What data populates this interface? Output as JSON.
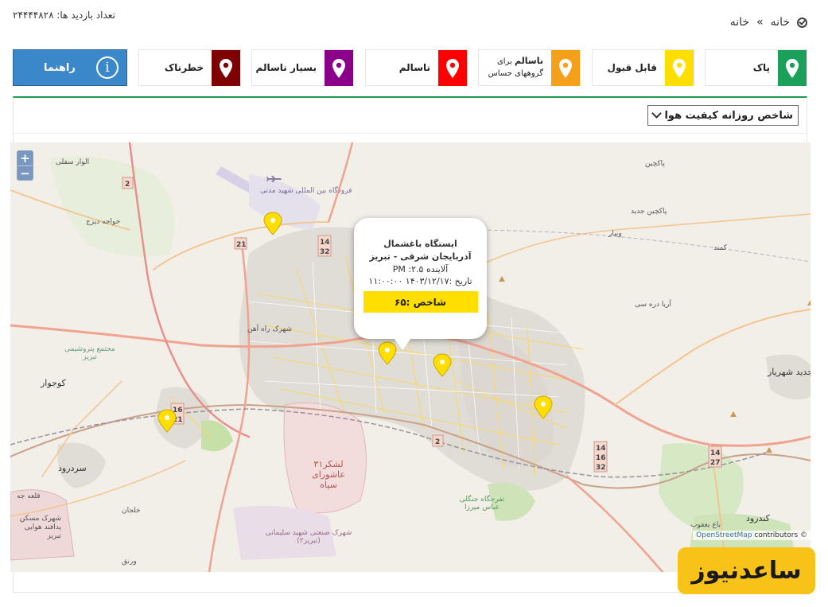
{
  "header": {
    "visit_count": "تعداد بازدید ها: ۲۴۴۴۴۸۲۸",
    "breadcrumb": [
      "خانه",
      "خانه"
    ],
    "breadcrumb_sep": "»"
  },
  "legend": [
    {
      "label": "پاک",
      "color": "#1aa05a"
    },
    {
      "label": "قابل قبول",
      "color": "#ffde00"
    },
    {
      "label_small": "برای",
      "label_bold": "ناسالم",
      "label_line2": "گروههای حساس",
      "color": "#f5a01a"
    },
    {
      "label": "ناسالم",
      "color": "#ff0000"
    },
    {
      "label": "بسیار ناسالم",
      "color": "#8b0089"
    },
    {
      "label": "خطرناک",
      "color": "#7e0000"
    }
  ],
  "guide_button": {
    "label": "راهنما",
    "icon": "info-icon",
    "color": "#3a87c9"
  },
  "index_select": {
    "value": "شاخص روزانه کیفیت هوا"
  },
  "map": {
    "zoom_in": "+",
    "zoom_out": "−",
    "attribution_link": "OpenStreetMap",
    "attribution_rest": " contributors ©",
    "labels": {
      "airport": "فرودگاه بین المللی شهید مدنی",
      "rah_ahan": "شهرک راه آهن",
      "sardrud": "سردرود",
      "gojovar": "کوجوار",
      "shahriar": "جدید شهریار",
      "kondrud": "کندرود",
      "militia": "لشکر۳۱ عاشورای سپاه",
      "sanati": "شهرک صنعتی شهید سلیمانی (تبریز۲)",
      "petro": "مجتمع پتروشیمی تبریز",
      "pakchin": "پاکچین",
      "pakchin_jadid": "پاکچین جدید",
      "vanyar": "ونیار",
      "kamand": "کمند",
      "arya": "آریا دره سی",
      "jangali": "تفرجگاه جنگلی عباس میرزا",
      "baagh": "باغ یعقوب",
      "khajeh": "خواجه دیزج",
      "alvar": "الوار سفلی",
      "qaleh": "قلعه جه",
      "khalajan": "خلجان",
      "vargh": "ورنق",
      "padafand": "شهرک مسکن پدافند هوایی تبریز"
    },
    "road_shields": [
      "2",
      "21",
      "14",
      "32",
      "16",
      "21",
      "2",
      "14",
      "16",
      "32",
      "14",
      "27"
    ],
    "pin_colors": {
      "acceptable": "#ffde00"
    },
    "popup": {
      "station": "ایستگاه باغشمال",
      "province": "آذربایجان شرقی - تبریز",
      "pollutant": "آلاینده ۲.۵: PM",
      "date": "تاریخ :۱۴۰۳/۱۲/۱۷ ۱۱:۰۰:۰۰",
      "index": "شاخص :۶۵"
    }
  },
  "watermark": "ساعدنیوز"
}
